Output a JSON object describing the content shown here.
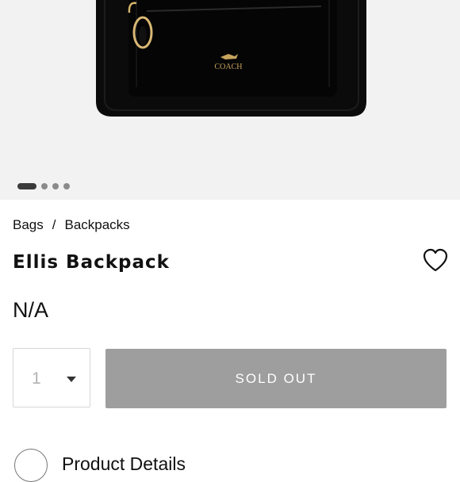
{
  "product": {
    "brand_mark": "COACH",
    "name": "Ellis Backpack",
    "price": "N/A"
  },
  "gallery": {
    "image_count": 4,
    "active_index": 0
  },
  "breadcrumb": {
    "items": [
      "Bags",
      "Backpacks"
    ],
    "separator": "/"
  },
  "purchase": {
    "quantity": "1",
    "button_label": "SOLD OUT"
  },
  "section": {
    "label": "Product Details"
  },
  "icons": {
    "wishlist": "heart-outline-icon",
    "quantity": "chevron-down-icon"
  },
  "colors": {
    "button_disabled": "#9e9e9e",
    "gallery_bg": "#f2f2f2",
    "text": "#111111"
  }
}
